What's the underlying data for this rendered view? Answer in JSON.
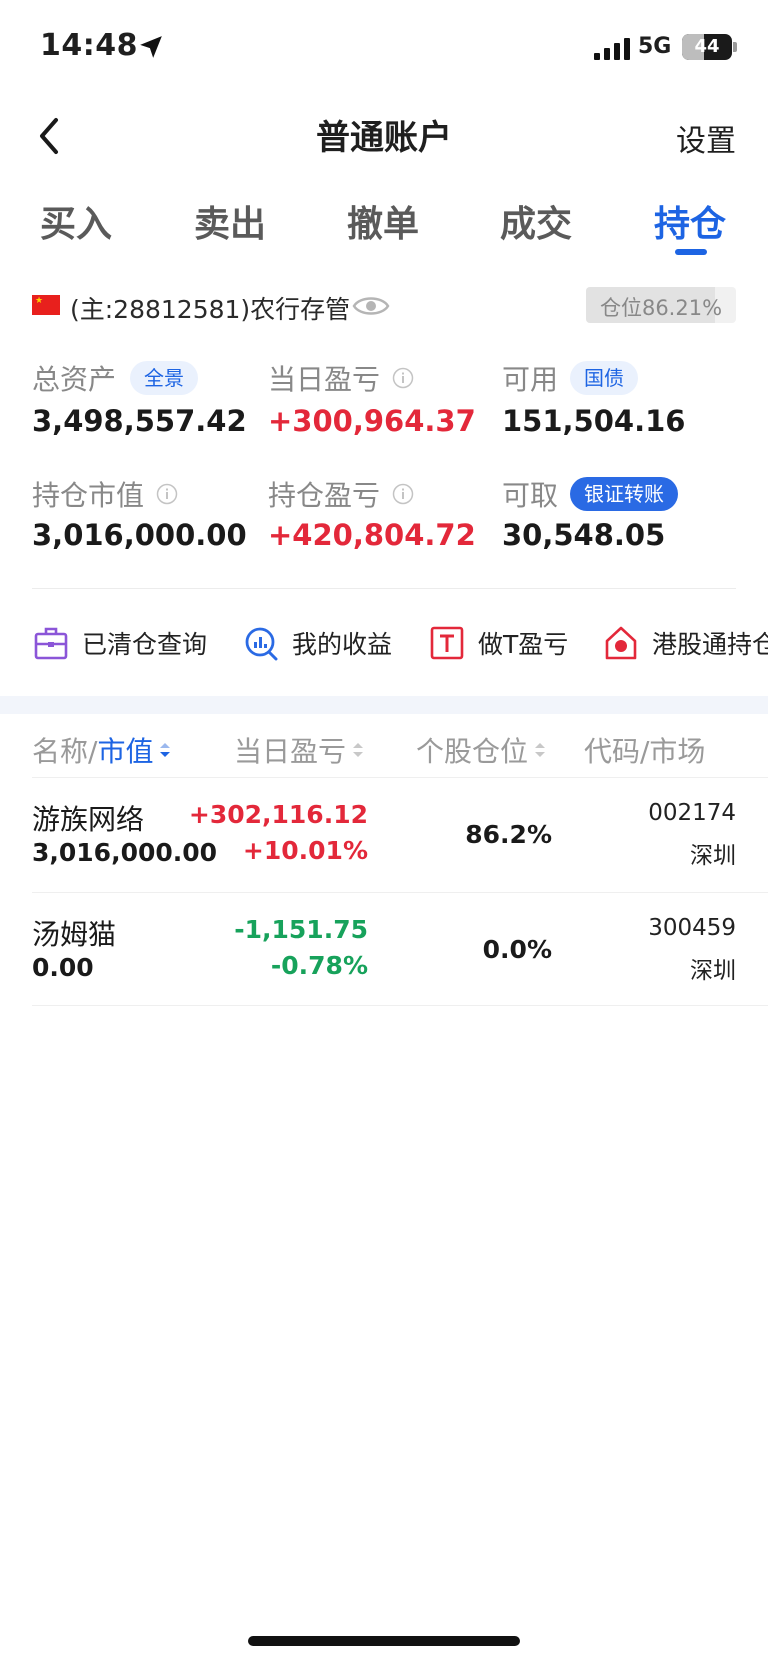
{
  "status_bar": {
    "time": "14:48",
    "network": "5G",
    "battery_level": "44",
    "battery_fraction": 0.44
  },
  "header": {
    "title": "普通账户",
    "settings_label": "设置",
    "back_icon": "chevron-left-icon"
  },
  "tabs": [
    {
      "label": "买入",
      "active": false
    },
    {
      "label": "卖出",
      "active": false
    },
    {
      "label": "撤单",
      "active": false
    },
    {
      "label": "成交",
      "active": false
    },
    {
      "label": "持仓",
      "active": true
    }
  ],
  "account": {
    "label": "(主:28812581)农行存管",
    "flag": "china-flag-icon",
    "position_ratio_text": "仓位86.21%",
    "position_ratio": 0.8621
  },
  "stats": {
    "total_assets_label": "总资产",
    "total_assets_badge": "全景",
    "total_assets_value": "3,498,557.42",
    "daily_pnl_label": "当日盈亏",
    "daily_pnl_value": "+300,964.37",
    "available_label": "可用",
    "available_badge": "国债",
    "available_value": "151,504.16",
    "market_value_label": "持仓市值",
    "market_value_value": "3,016,000.00",
    "position_pnl_label": "持仓盈亏",
    "position_pnl_value": "+420,804.72",
    "withdrawable_label": "可取",
    "withdrawable_badge": "银证转账",
    "withdrawable_value": "30,548.05"
  },
  "shortcuts": [
    {
      "label": "已清仓查询",
      "icon": "briefcase-icon"
    },
    {
      "label": "我的收益",
      "icon": "chart-search-icon"
    },
    {
      "label": "做T盈亏",
      "icon": "t-box-icon"
    },
    {
      "label": "港股通持仓",
      "icon": "hk-house-icon"
    }
  ],
  "table": {
    "col_name_prefix": "名称/",
    "col_name_sort": "市值",
    "col_daily": "当日盈亏",
    "col_weight": "个股仓位",
    "col_code": "代码/市场",
    "rows": [
      {
        "name": "游族网络",
        "market_value": "3,016,000.00",
        "pnl": "+302,116.12",
        "pnl_pct": "+10.01%",
        "weight": "86.2%",
        "code": "002174",
        "market": "深圳",
        "trend": "up"
      },
      {
        "name": "汤姆猫",
        "market_value": "0.00",
        "pnl": "-1,151.75",
        "pnl_pct": "-0.78%",
        "weight": "0.0%",
        "code": "300459",
        "market": "深圳",
        "trend": "down"
      }
    ]
  },
  "colors": {
    "accent": "#1d64e3",
    "up": "#e3283a",
    "down": "#17a25b"
  }
}
